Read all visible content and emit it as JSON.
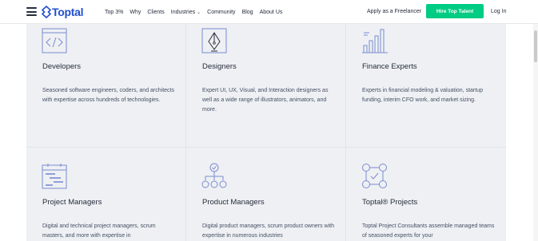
{
  "nav": {
    "logo_text": "Toptal",
    "logo_dot": ".",
    "links": [
      {
        "label": "Top 3%",
        "has_caret": false
      },
      {
        "label": "Why",
        "has_caret": false
      },
      {
        "label": "Clients",
        "has_caret": false
      },
      {
        "label": "Industries",
        "has_caret": true
      },
      {
        "label": "Community",
        "has_caret": false
      },
      {
        "label": "Blog",
        "has_caret": false
      },
      {
        "label": "About Us",
        "has_caret": false
      }
    ],
    "caret_glyph": "⌄",
    "apply_label": "Apply as a Freelancer",
    "hire_label": "Hire Top Talent",
    "login_label": "Log In"
  },
  "colors": {
    "brand_blue": "#204ecf",
    "hire_green": "#00cc83",
    "grid_bg": "#eef0f3",
    "icon_stroke": "#7b8bd1"
  },
  "cards": [
    {
      "icon": "code-window-icon",
      "title": "Developers",
      "description": "Seasoned software engineers, coders, and architects with expertise across hundreds of technologies."
    },
    {
      "icon": "pen-nib-icon",
      "title": "Designers",
      "description": "Expert UI, UX, Visual, and Interaction designers as well as a wide range of illustrators, animators, and more."
    },
    {
      "icon": "bar-chart-icon",
      "title": "Finance Experts",
      "description": "Experts in financial modeling & valuation, startup funding, interim CFO work, and market sizing."
    },
    {
      "icon": "gantt-chart-icon",
      "title": "Project Managers",
      "description": "Digital and technical project managers, scrum masters, and more with expertise in"
    },
    {
      "icon": "org-chart-icon",
      "title": "Product Managers",
      "description": "Digital product managers, scrum product owners with expertise in numerous industries"
    },
    {
      "icon": "team-network-icon",
      "title": "Toptal® Projects",
      "description": "Toptal Project Consultants assemble managed teams of seasoned experts for your"
    }
  ]
}
